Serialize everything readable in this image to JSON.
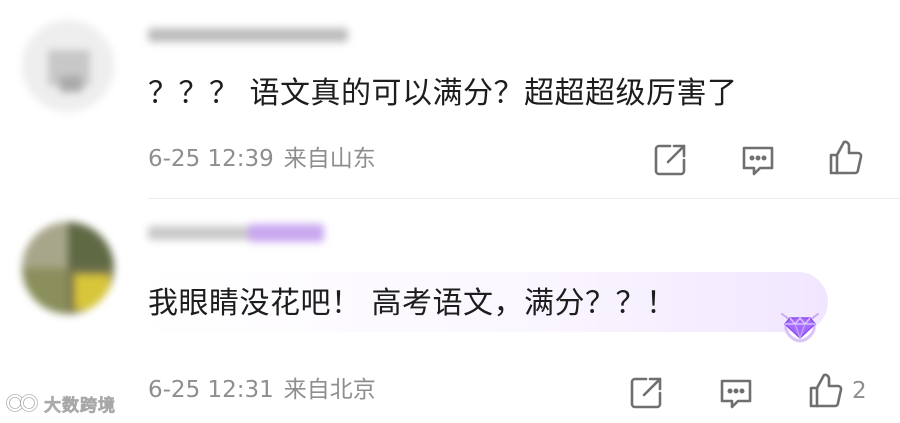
{
  "comments": [
    {
      "text": "？？？ 语文真的可以满分？超超超级厉害了",
      "time": "6-25 12:39",
      "location": "来自山东",
      "likes": ""
    },
    {
      "text": "我眼睛没花吧！ 高考语文，满分？？！",
      "time": "6-25 12:31",
      "location": "来自北京",
      "likes": "2"
    }
  ],
  "icons": {
    "share": "share-icon",
    "reply": "comment-icon",
    "like": "thumbs-up-icon",
    "badge": "diamond-badge-icon"
  },
  "colors": {
    "meta_text": "#8e8e8e",
    "icon_stroke": "#6f6f6f",
    "badge_purple": "#a66bff"
  },
  "watermark": {
    "text": "大数跨境"
  }
}
